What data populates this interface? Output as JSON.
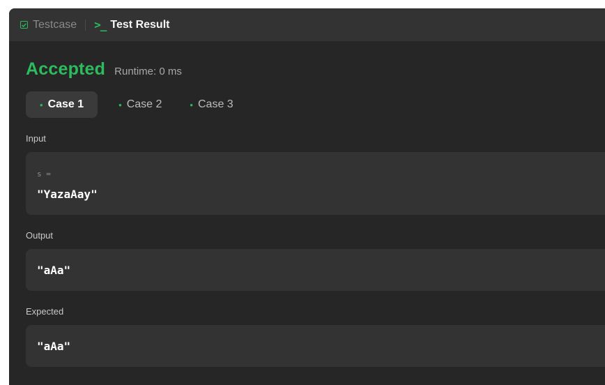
{
  "tabs": {
    "testcase_label": "Testcase",
    "result_label": "Test Result"
  },
  "result": {
    "status": "Accepted",
    "runtime": "Runtime: 0 ms"
  },
  "cases": [
    {
      "label": "Case 1",
      "active": true
    },
    {
      "label": "Case 2",
      "active": false
    },
    {
      "label": "Case 3",
      "active": false
    }
  ],
  "input": {
    "section_label": "Input",
    "var_name": "s =",
    "value": "\"YazaAay\""
  },
  "output": {
    "section_label": "Output",
    "value": "\"aAa\""
  },
  "expected": {
    "section_label": "Expected",
    "value": "\"aAa\""
  },
  "colors": {
    "accent": "#2cbb5d",
    "panel_bg": "#262626",
    "box_bg": "#333333"
  },
  "icons": {
    "testcase": "checkbox-icon",
    "result": "terminal-icon",
    "case_dot": "dot-icon"
  }
}
